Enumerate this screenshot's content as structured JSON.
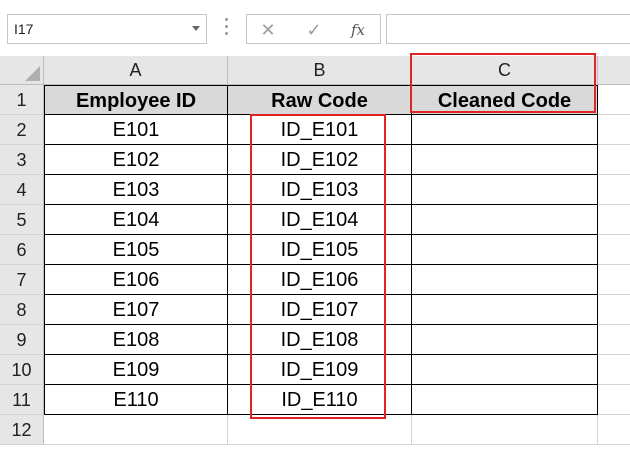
{
  "formula_bar": {
    "name_box": "I17",
    "cancel_icon": "✕",
    "enter_icon": "✓",
    "fx_label": "fx",
    "formula": ""
  },
  "columns": [
    "A",
    "B",
    "C"
  ],
  "rows": [
    "1",
    "2",
    "3",
    "4",
    "5",
    "6",
    "7",
    "8",
    "9",
    "10",
    "11",
    "12"
  ],
  "table": {
    "headers": [
      "Employee ID",
      "Raw Code",
      "Cleaned Code"
    ],
    "data": [
      [
        "E101",
        "ID_E101",
        ""
      ],
      [
        "E102",
        "ID_E102",
        ""
      ],
      [
        "E103",
        "ID_E103",
        ""
      ],
      [
        "E104",
        "ID_E104",
        ""
      ],
      [
        "E105",
        "ID_E105",
        ""
      ],
      [
        "E106",
        "ID_E106",
        ""
      ],
      [
        "E107",
        "ID_E107",
        ""
      ],
      [
        "E108",
        "ID_E108",
        ""
      ],
      [
        "E109",
        "ID_E109",
        ""
      ],
      [
        "E110",
        "ID_E110",
        ""
      ]
    ]
  },
  "colors": {
    "header_fill": "#d9d9d9",
    "highlight_box": "#e02424"
  }
}
